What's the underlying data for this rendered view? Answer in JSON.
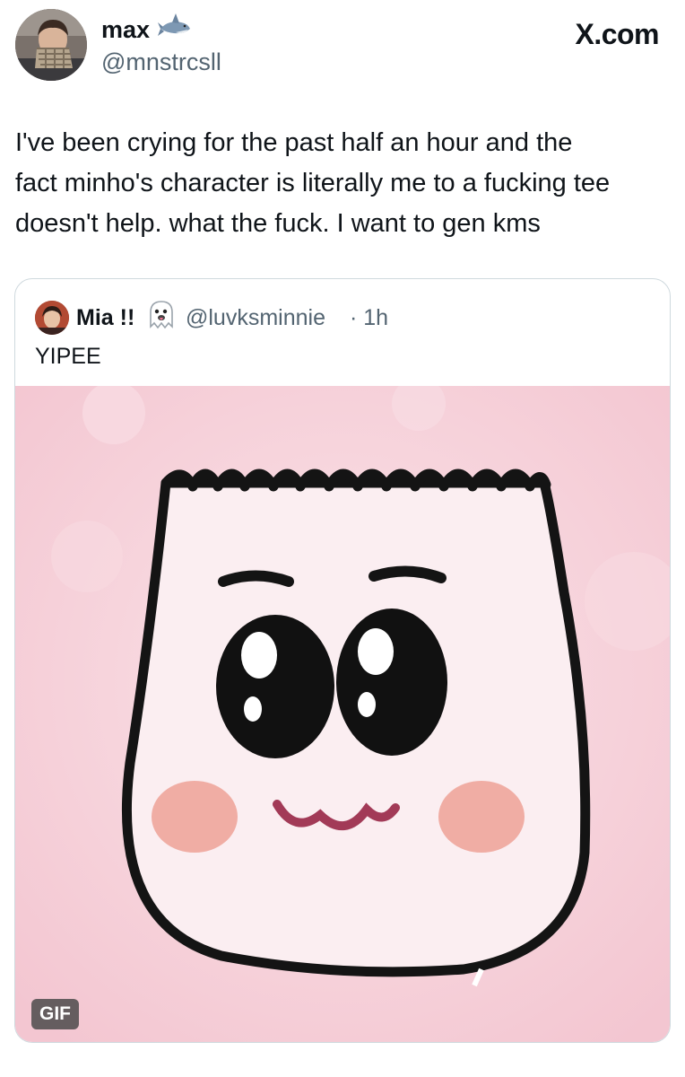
{
  "author": {
    "display_name": "max",
    "handle": "@mnstrcsll",
    "avatar_icon": "profile-photo",
    "emoji_icon": "shark-icon"
  },
  "site_label": "X.com",
  "tweet": {
    "text": "I've been crying for the past half an hour and the\nfact minho's character is literally me to a fucking tee\ndoesn't help. what the fuck. I want to gen kms"
  },
  "quoted": {
    "display_name": "Mia !!",
    "emoji_icon": "ghost-icon",
    "handle": "@luvksminnie",
    "time": "· 1h",
    "text": "YIPEE",
    "media_badge": "GIF"
  },
  "colors": {
    "muted_text": "#536471",
    "border": "#cfd9de",
    "gif_background": "#f7d4dc",
    "blush": "#eea59b",
    "mouth": "#a23a57"
  }
}
